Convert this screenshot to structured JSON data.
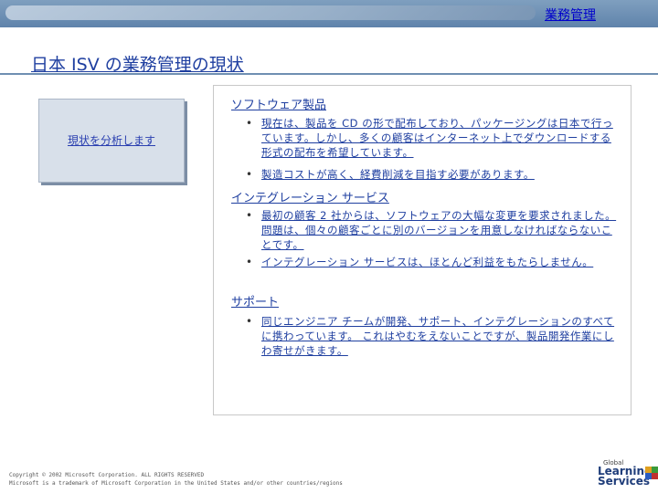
{
  "header": {
    "section_label": "業務管理"
  },
  "page": {
    "title": "日本 ISV の業務管理の現状"
  },
  "side_card": {
    "label": "現状を分析します"
  },
  "sections": [
    {
      "heading": "ソフトウェア製品",
      "bullets": [
        "現在は、製品を CD の形で配布しており、パッケージングは日本で行っています。しかし、多くの顧客はインターネット上でダウンロードする形式の配布を希望しています。",
        "製造コストが高く、経費削減を目指す必要があります。"
      ]
    },
    {
      "heading": "インテグレーション サービス",
      "bullets": [
        "最初の顧客 2 社からは、ソフトウェアの大幅な変更を要求されました。 問題は、個々の顧客ごとに別のバージョンを用意しなければならないことです。",
        "インテグレーション サービスは、ほとんど利益をもたらしません。"
      ]
    },
    {
      "heading": "サポート",
      "bullets": [
        "同じエンジニア チームが開発、サポート、インテグレーションのすべてに携わっています。 これはやむをえないことですが、製品開発作業にしわ寄せがきます。"
      ]
    }
  ],
  "footer": {
    "line1": "Copyright © 2002 Microsoft Corporation. ALL RIGHTS RESERVED",
    "line2": "Microsoft is a trademark of Microsoft Corporation in the United States and/or other countries/regions"
  },
  "logo": {
    "small": "Global",
    "line1": "Learning",
    "line2": "Services"
  },
  "colors": {
    "accent": "#1f3fa0",
    "bar": "#5f83ab"
  }
}
